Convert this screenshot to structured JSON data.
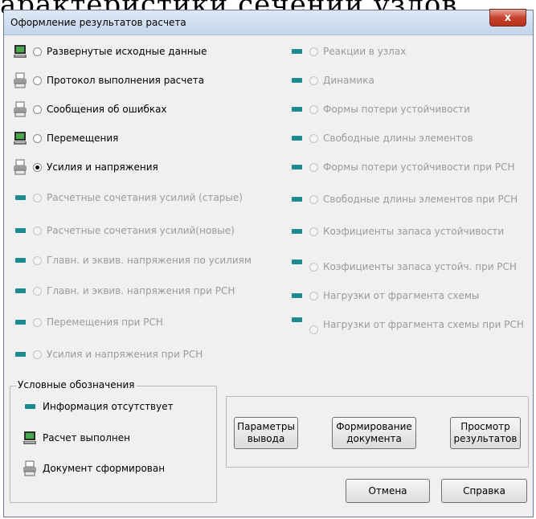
{
  "background_text": "арактеристики сечений узлов",
  "dialog": {
    "title": "Оформление результатов расчета",
    "close_glyph": "x"
  },
  "left_options": [
    {
      "label": "Развернутые исходные данные",
      "icon": "computer-icon",
      "enabled": true,
      "checked": false
    },
    {
      "label": "Протокол выполнения расчета",
      "icon": "printer-icon",
      "enabled": true,
      "checked": false
    },
    {
      "label": "Сообщения об ошибках",
      "icon": "printer-icon",
      "enabled": true,
      "checked": false
    },
    {
      "label": "Перемещения",
      "icon": "computer-icon",
      "enabled": true,
      "checked": false
    },
    {
      "label": "Усилия и напряжения",
      "icon": "printer-icon",
      "enabled": true,
      "checked": true
    },
    {
      "label": "Расчетные сочетания усилий (старые)",
      "icon": "dash-icon",
      "enabled": false,
      "checked": false
    },
    {
      "label": "Расчетные сочетания усилий(новые)",
      "icon": "dash-icon",
      "enabled": false,
      "checked": false
    },
    {
      "label": "Главн. и эквив. напряжения по усилиям",
      "icon": "dash-icon",
      "enabled": false,
      "checked": false
    },
    {
      "label": "Главн. и эквив. напряжения при РСН",
      "icon": "dash-icon",
      "enabled": false,
      "checked": false
    },
    {
      "label": "Перемещения при РСН",
      "icon": "dash-icon",
      "enabled": false,
      "checked": false
    },
    {
      "label": "Усилия и напряжения при РСН",
      "icon": "dash-icon",
      "enabled": false,
      "checked": false
    }
  ],
  "right_options": [
    {
      "label": "Реакции в узлах",
      "icon": "dash-icon",
      "enabled": false
    },
    {
      "label": "Динамика",
      "icon": "dash-icon",
      "enabled": false
    },
    {
      "label": "Формы потери устойчивости",
      "icon": "dash-icon",
      "enabled": false
    },
    {
      "label": "Свободные длины элементов",
      "icon": "dash-icon",
      "enabled": false
    },
    {
      "label": "Формы потери устойчивости при РСН",
      "icon": "dash-icon",
      "enabled": false
    },
    {
      "label": "Свободные длины элементов при РСН",
      "icon": "dash-icon",
      "enabled": false
    },
    {
      "label": "Коэфициенты запаса устойчивости",
      "icon": "dash-icon",
      "enabled": false
    },
    {
      "label": "Коэфициенты запаса устойч. при РСН",
      "icon": "dash-icon",
      "enabled": false
    },
    {
      "label": "Нагрузки от фрагмента схемы",
      "icon": "dash-icon",
      "enabled": false
    },
    {
      "label": "Нагрузки от фрагмента схемы при РСН",
      "icon": "dash-icon",
      "enabled": false
    }
  ],
  "legend": {
    "title": "Условные обозначения",
    "items": [
      {
        "label": "Информация отсутствует",
        "icon": "dash-icon"
      },
      {
        "label": "Расчет выполнен",
        "icon": "computer-icon"
      },
      {
        "label": "Документ сформирован",
        "icon": "printer-icon"
      }
    ]
  },
  "buttons": {
    "params": "Параметры вывода",
    "form_doc": "Формирование документа",
    "view": "Просмотр результатов",
    "cancel": "Отмена",
    "help": "Справка"
  },
  "colors": {
    "accent": "#1a8c91",
    "close": "#c8432d",
    "disabled_text": "#9a9a9a"
  }
}
